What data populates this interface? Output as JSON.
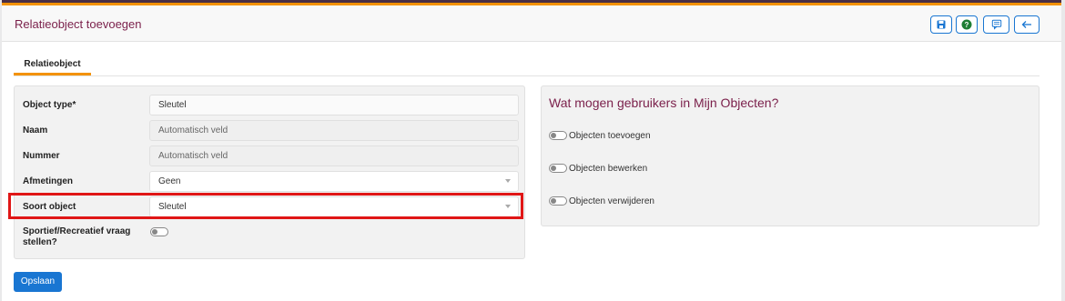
{
  "header": {
    "title": "Relatieobject toevoegen",
    "actions": [
      {
        "icon": "save-icon"
      },
      {
        "icon": "help-icon"
      },
      {
        "icon": "comment-icon"
      },
      {
        "icon": "back-arrow-icon"
      }
    ]
  },
  "tabs": [
    {
      "label": "Relatieobject",
      "active": true
    }
  ],
  "form": {
    "object_type": {
      "label": "Object type*",
      "value": "Sleutel"
    },
    "naam": {
      "label": "Naam",
      "placeholder": "Automatisch veld"
    },
    "nummer": {
      "label": "Nummer",
      "placeholder": "Automatisch veld"
    },
    "afmetingen": {
      "label": "Afmetingen",
      "value": "Geen"
    },
    "soort_object": {
      "label": "Soort object",
      "value": "Sleutel"
    },
    "sportief": {
      "label_line1": "Sportief/Recreatief vraag",
      "label_line2": "stellen?",
      "on": false
    }
  },
  "permissions": {
    "title": "Wat mogen gebruikers in Mijn Objecten?",
    "items": [
      {
        "label": "Objecten toevoegen",
        "on": false
      },
      {
        "label": "Objecten bewerken",
        "on": false
      },
      {
        "label": "Objecten verwijderen",
        "on": false
      }
    ]
  },
  "save_label": "Opslaan",
  "colors": {
    "accent": "#1976d2",
    "title": "#7a1f4a",
    "orange": "#f39200",
    "highlight": "#e01616",
    "help_green": "#1e7e34"
  }
}
